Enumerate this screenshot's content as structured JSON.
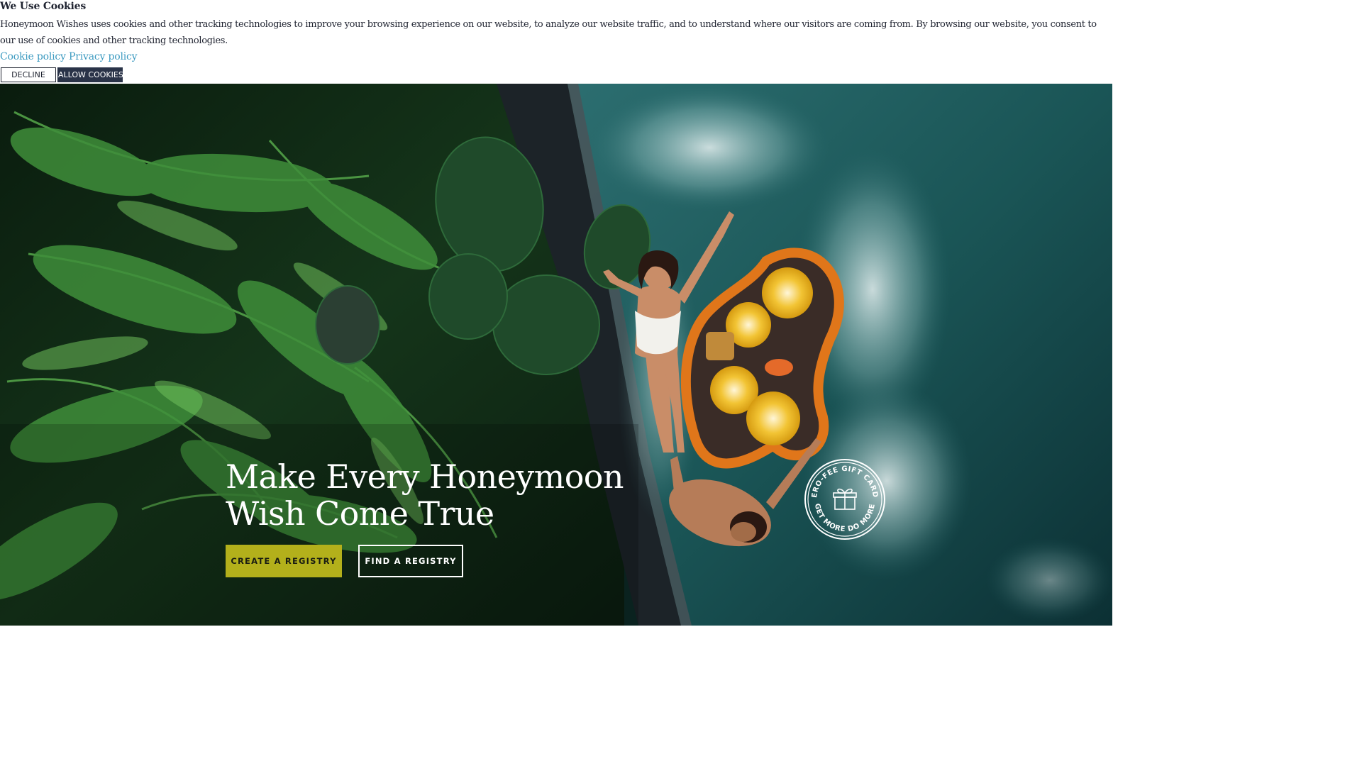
{
  "cookie_banner": {
    "title": "We Use Cookies",
    "text": "Honeymoon Wishes uses cookies and other tracking technologies to improve your browsing experience on our website, to analyze our website traffic, and to understand where our visitors are coming from. By browsing our website, you consent to our use of cookies and other tracking technologies.",
    "cookie_policy_link": "Cookie policy",
    "privacy_policy_link": "Privacy policy",
    "decline_label": "DECLINE",
    "allow_label": "ALLOW COOKIES",
    "link_color": "#3d9bc1",
    "allow_bg_color": "#2a3348"
  },
  "hero": {
    "heading_line1": "Make Every Honeymoon",
    "heading_line2": "Wish Come True",
    "create_registry_label": "CREATE A REGISTRY",
    "find_registry_label": "FIND A REGISTRY",
    "create_button_color": "#b3b01b",
    "background_description_icons": [
      "fern-foliage",
      "pool-water",
      "floating-breakfast-tray"
    ],
    "badge": {
      "top_text": "ZERO-FEE GIFT CARDS",
      "bottom_text": "GET MORE DO MORE",
      "icon": "gift-icon"
    }
  }
}
